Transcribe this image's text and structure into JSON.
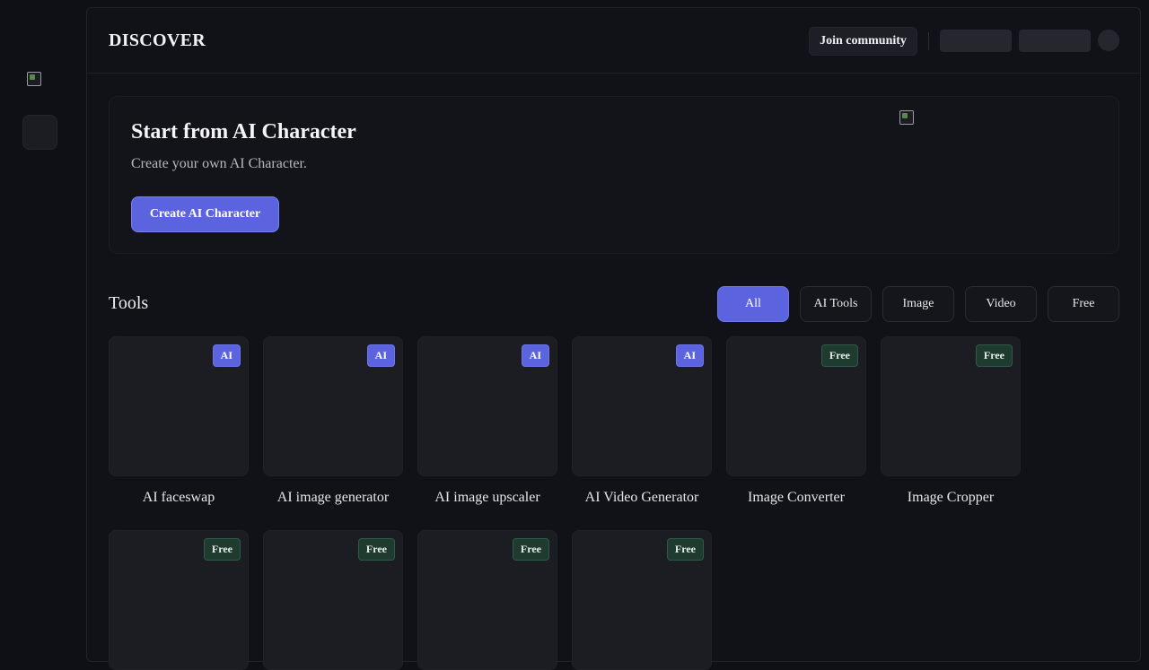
{
  "header": {
    "title": "DISCOVER",
    "join_label": "Join community"
  },
  "hero": {
    "title": "Start from AI Character",
    "subtitle": "Create your own AI Character.",
    "button_label": "Create AI Character"
  },
  "tools": {
    "title": "Tools",
    "filters": [
      {
        "label": "All",
        "active": true
      },
      {
        "label": "AI Tools",
        "active": false
      },
      {
        "label": "Image",
        "active": false
      },
      {
        "label": "Video",
        "active": false
      },
      {
        "label": "Free",
        "active": false
      }
    ],
    "items": [
      {
        "label": "AI faceswap",
        "badge": "AI"
      },
      {
        "label": "AI image generator",
        "badge": "AI"
      },
      {
        "label": "AI image upscaler",
        "badge": "AI"
      },
      {
        "label": "AI Video Generator",
        "badge": "AI"
      },
      {
        "label": "Image Converter",
        "badge": "Free"
      },
      {
        "label": "Image Cropper",
        "badge": "Free"
      },
      {
        "label": "",
        "badge": "Free"
      },
      {
        "label": "",
        "badge": "Free"
      },
      {
        "label": "",
        "badge": "Free"
      },
      {
        "label": "",
        "badge": "Free"
      }
    ]
  },
  "colors": {
    "accent": "#5b64de",
    "free_badge": "#1f3b30",
    "background": "#0f1015"
  }
}
